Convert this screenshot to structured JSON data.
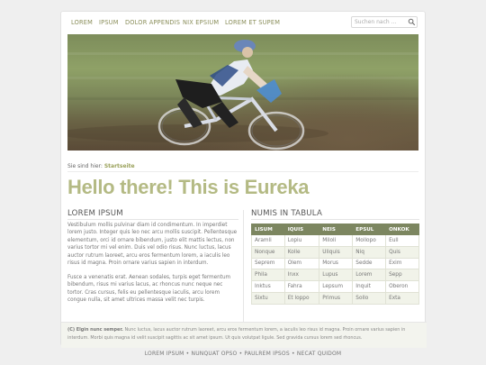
{
  "nav": {
    "items": [
      "LOREM",
      "IPSUM",
      "DOLOR APPENDIS",
      "NIX EPSIUM",
      "LOREM ET SUPEM"
    ],
    "search_placeholder": "Suchen nach ...",
    "search_icon": "magnifier-icon"
  },
  "hero": {
    "image": "blurred cyclist riding mountain bike on dirt trail"
  },
  "breadcrumb": {
    "prefix": "Sie sind hier:",
    "link": "Startseite"
  },
  "headline": "Hello there! This is Eureka",
  "left": {
    "title": "LOREM IPSUM",
    "p1": "Vestibulum mollis pulvinar diam id condimentum. In imperdiet lorem justo. Integer quis leo nec arcu mollis suscipit. Pellentesque elementum, orci id ornare bibendum, justo elit mattis lectus, non varius tortor mi vel enim. Duis vel odio risus. Nunc luctus, lacus auctor rutrum laoreet, arcu eros fermentum lorem, a iaculis leo risus id magna. Proin ornare varius sapien in interdum.",
    "p2": "Fusce a venenatis erat. Aenean sodales, turpis eget fermentum bibendum, risus mi varius lacus, ac rhoncus nunc neque nec tortor. Cras cursus, felis eu pellentesque iaculis, arcu lorem congue nulla, sit amet ultrices massa velit nec turpis."
  },
  "right": {
    "title": "NUMIS IN TABULA",
    "headers": [
      "LISUM",
      "IQUIS",
      "NEIS",
      "EPSUL",
      "ONKOK"
    ],
    "rows": [
      [
        "Aramli",
        "Lopiu",
        "Miloli",
        "Mollopo",
        "Eull"
      ],
      [
        "Nonque",
        "Kolle",
        "Uliquis",
        "Niq",
        "Quis"
      ],
      [
        "Seprem",
        "Olem",
        "Morus",
        "Sedde",
        "Exim"
      ],
      [
        "Phila",
        "Inxx",
        "Lupus",
        "Lorem",
        "Sepp"
      ],
      [
        "Inktus",
        "Fahra",
        "Lepsum",
        "Inquit",
        "Oberon"
      ],
      [
        "Sixtu",
        "Et loppo",
        "Primus",
        "Sollo",
        "Exta"
      ]
    ]
  },
  "footer": {
    "copyright": "(C) Elgin nunc semper.",
    "text": "Nunc luctus, lacus auctor rutrum laoreet, arcu eros fermentum lorem, a iaculis leo risus id magna. Proin ornare varius sapien in interdum. Morbi quis magna id velit suscipit sagittis ac sit amet ipsum. Ut quis volutpat ligule. Sed gravida cursus lorem sed rhoncus."
  },
  "bottom_links": "LOREM IPSUM • NUNQUAT OPSO • PAULREM IPSOS • NECAT QUIDOM"
}
